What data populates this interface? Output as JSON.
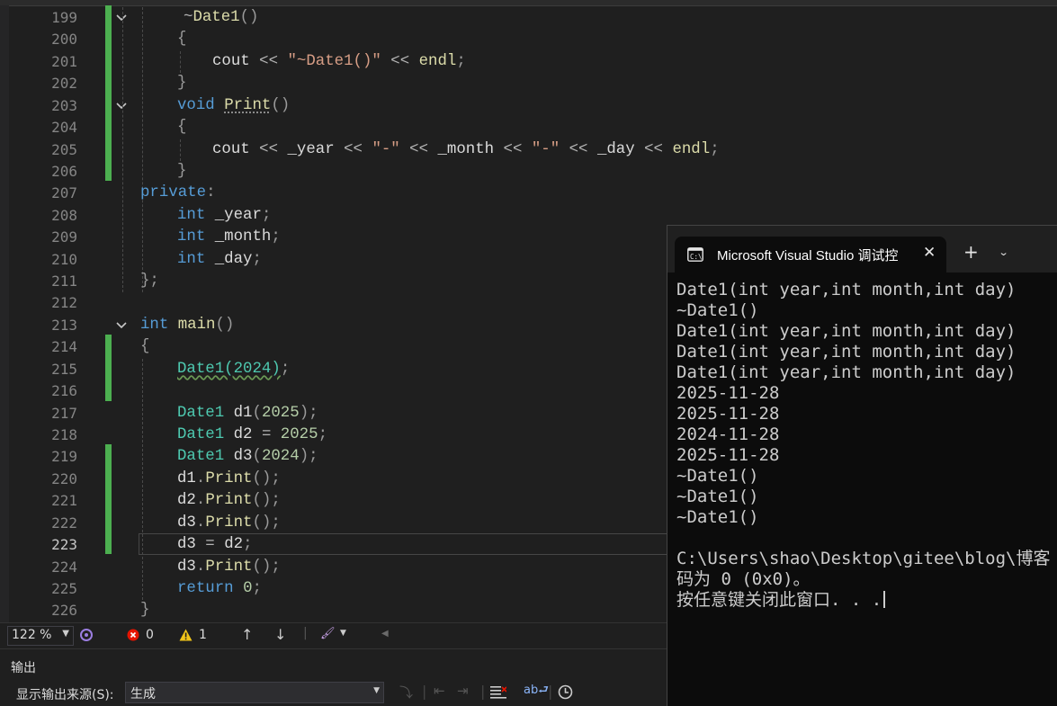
{
  "editor": {
    "line_numbers": [
      "199",
      "200",
      "201",
      "202",
      "203",
      "204",
      "205",
      "206",
      "207",
      "208",
      "209",
      "210",
      "211",
      "212",
      "213",
      "214",
      "215",
      "216",
      "217",
      "218",
      "219",
      "220",
      "221",
      "222",
      "223",
      "224",
      "225",
      "226"
    ],
    "active_line": "223",
    "code_lines": [
      [
        {
          "t": "~",
          "c": "op"
        },
        {
          "t": "Date1",
          "c": "fn"
        },
        {
          "t": "()",
          "c": "pm"
        }
      ],
      [
        {
          "t": "{",
          "c": "pm"
        }
      ],
      [
        {
          "t": "cout",
          "c": "var"
        },
        {
          "t": " << ",
          "c": "op"
        },
        {
          "t": "\"~Date1()\"",
          "c": "str"
        },
        {
          "t": " << ",
          "c": "op"
        },
        {
          "t": "endl",
          "c": "fn"
        },
        {
          "t": ";",
          "c": "pm"
        }
      ],
      [
        {
          "t": "}",
          "c": "pm"
        }
      ],
      [
        {
          "t": "void",
          "c": "kw"
        },
        {
          "t": " ",
          "c": "var"
        },
        {
          "t": "Print",
          "c": "fn dots"
        },
        {
          "t": "()",
          "c": "pm"
        }
      ],
      [
        {
          "t": "{",
          "c": "pm"
        }
      ],
      [
        {
          "t": "cout",
          "c": "var"
        },
        {
          "t": " << ",
          "c": "op"
        },
        {
          "t": "_year",
          "c": "mem"
        },
        {
          "t": " << ",
          "c": "op"
        },
        {
          "t": "\"-\"",
          "c": "str"
        },
        {
          "t": " << ",
          "c": "op"
        },
        {
          "t": "_month",
          "c": "mem"
        },
        {
          "t": " << ",
          "c": "op"
        },
        {
          "t": "\"-\"",
          "c": "str"
        },
        {
          "t": " << ",
          "c": "op"
        },
        {
          "t": "_day",
          "c": "mem"
        },
        {
          "t": " << ",
          "c": "op"
        },
        {
          "t": "endl",
          "c": "fn"
        },
        {
          "t": ";",
          "c": "pm"
        }
      ],
      [
        {
          "t": "}",
          "c": "pm"
        }
      ],
      [
        {
          "t": "private",
          "c": "kw"
        },
        {
          "t": ":",
          "c": "pm"
        }
      ],
      [
        {
          "t": "int",
          "c": "kw"
        },
        {
          "t": " _year",
          "c": "mem"
        },
        {
          "t": ";",
          "c": "pm"
        }
      ],
      [
        {
          "t": "int",
          "c": "kw"
        },
        {
          "t": " _month",
          "c": "mem"
        },
        {
          "t": ";",
          "c": "pm"
        }
      ],
      [
        {
          "t": "int",
          "c": "kw"
        },
        {
          "t": " _day",
          "c": "mem"
        },
        {
          "t": ";",
          "c": "pm"
        }
      ],
      [
        {
          "t": "};",
          "c": "pm"
        }
      ],
      [],
      [
        {
          "t": "int",
          "c": "kw"
        },
        {
          "t": " ",
          "c": "var"
        },
        {
          "t": "main",
          "c": "fn"
        },
        {
          "t": "()",
          "c": "pm"
        }
      ],
      [
        {
          "t": "{",
          "c": "pm"
        }
      ],
      [
        {
          "t": "Date1(2024)",
          "c": "ty squig"
        },
        {
          "t": ";",
          "c": "pm"
        }
      ],
      [],
      [
        {
          "t": "Date1",
          "c": "ty"
        },
        {
          "t": " d1",
          "c": "var"
        },
        {
          "t": "(",
          "c": "pm"
        },
        {
          "t": "2025",
          "c": "num"
        },
        {
          "t": ");",
          "c": "pm"
        }
      ],
      [
        {
          "t": "Date1",
          "c": "ty"
        },
        {
          "t": " d2 ",
          "c": "var"
        },
        {
          "t": "=",
          "c": "op"
        },
        {
          "t": " 2025",
          "c": "num"
        },
        {
          "t": ";",
          "c": "pm"
        }
      ],
      [
        {
          "t": "Date1",
          "c": "ty"
        },
        {
          "t": " d3",
          "c": "var"
        },
        {
          "t": "(",
          "c": "pm"
        },
        {
          "t": "2024",
          "c": "num"
        },
        {
          "t": ");",
          "c": "pm"
        }
      ],
      [
        {
          "t": "d1",
          "c": "var"
        },
        {
          "t": ".",
          "c": "pm"
        },
        {
          "t": "Print",
          "c": "fn"
        },
        {
          "t": "();",
          "c": "pm"
        }
      ],
      [
        {
          "t": "d2",
          "c": "var"
        },
        {
          "t": ".",
          "c": "pm"
        },
        {
          "t": "Print",
          "c": "fn"
        },
        {
          "t": "();",
          "c": "pm"
        }
      ],
      [
        {
          "t": "d3",
          "c": "var"
        },
        {
          "t": ".",
          "c": "pm"
        },
        {
          "t": "Print",
          "c": "fn"
        },
        {
          "t": "();",
          "c": "pm"
        }
      ],
      [
        {
          "t": "d3",
          "c": "var"
        },
        {
          "t": " = ",
          "c": "op"
        },
        {
          "t": "d2",
          "c": "var"
        },
        {
          "t": ";",
          "c": "pm"
        }
      ],
      [
        {
          "t": "d3",
          "c": "var"
        },
        {
          "t": ".",
          "c": "pm"
        },
        {
          "t": "Print",
          "c": "fn"
        },
        {
          "t": "();",
          "c": "pm"
        }
      ],
      [
        {
          "t": "return",
          "c": "kw"
        },
        {
          "t": " ",
          "c": "var"
        },
        {
          "t": "0",
          "c": "num"
        },
        {
          "t": ";",
          "c": "pm"
        }
      ],
      [
        {
          "t": "}",
          "c": "pm"
        }
      ]
    ]
  },
  "status": {
    "zoom": "122 %",
    "errors": "0",
    "warnings": "1"
  },
  "output": {
    "title": "输出",
    "source_label": "显示输出来源(S):",
    "source_value": "生成"
  },
  "console": {
    "tab_title": "Microsoft Visual Studio 调试控",
    "lines": [
      "Date1(int year,int month,int day)",
      "~Date1()",
      "Date1(int year,int month,int day)",
      "Date1(int year,int month,int day)",
      "Date1(int year,int month,int day)",
      "2025-11-28",
      "2025-11-28",
      "2024-11-28",
      "2025-11-28",
      "~Date1()",
      "~Date1()",
      "~Date1()",
      "",
      "C:\\Users\\shao\\Desktop\\gitee\\blog\\博客",
      "码为 0 (0x0)。",
      "按任意键关闭此窗口. . ."
    ]
  },
  "colors": {
    "editor_bg": "#1f1f1f",
    "console_bg": "#0c0c0c",
    "change_bar": "#4caf50",
    "keyword": "#569cd6",
    "type": "#4ec9b0",
    "function": "#dcdcaa",
    "number": "#b5cea8",
    "string": "#d69d85"
  }
}
